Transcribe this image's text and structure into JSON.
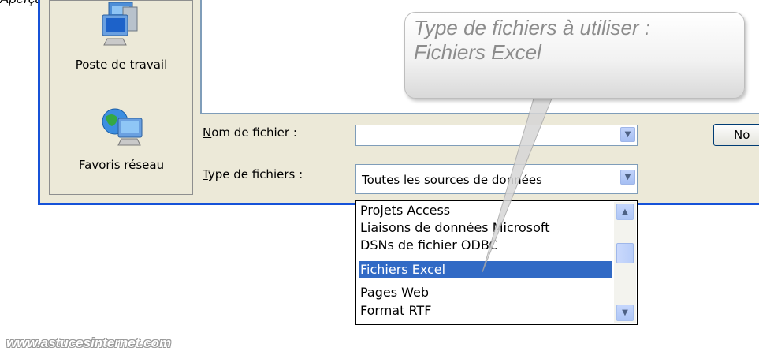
{
  "top_cut_text": "Aperçu :",
  "places": [
    {
      "label": "Poste de travail",
      "icon": "computer-icon"
    },
    {
      "label": "Favoris réseau",
      "icon": "network-icon"
    }
  ],
  "fields": {
    "filename": {
      "label_first": "N",
      "label_rest": "om de fichier :",
      "value": ""
    },
    "filetype": {
      "label_first": "T",
      "label_rest": "ype de fichiers :",
      "value": "Toutes les sources de données"
    }
  },
  "button_new_label": "No",
  "dropdown_options": [
    "Projets Access",
    "Liaisons de données Microsoft",
    "DSNs de fichier ODBC",
    "Fichiers Excel",
    "Pages Web",
    "Format RTF"
  ],
  "selected_option": "Fichiers Excel",
  "callout_text": {
    "line1": "Type de fichiers à utiliser :",
    "line2": "Fichiers Excel"
  },
  "watermark": "www.astucesinternet.com",
  "colors": {
    "dialog_border": "#1652d8",
    "selection": "#316ac5",
    "dialog_bg": "#ece9d8"
  }
}
